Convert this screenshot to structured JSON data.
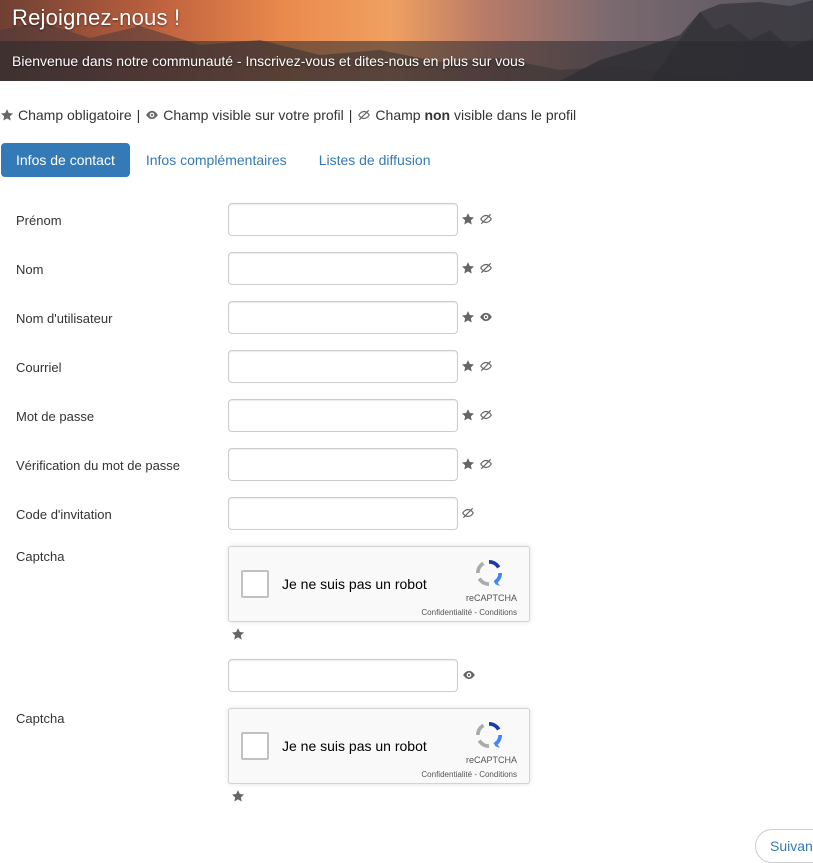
{
  "banner": {
    "title": "Rejoignez-nous !",
    "subtitle": "Bienvenue dans notre communauté - Inscrivez-vous et dites-nous en plus sur vous"
  },
  "legend": {
    "required": "Champ obligatoire",
    "separator": "|",
    "visible": "Champ visible sur votre profil",
    "not_visible_prefix": "Champ",
    "not_visible_bold": "non",
    "not_visible_suffix": "visible dans le profil"
  },
  "tabs": [
    {
      "label": "Infos de contact",
      "active": true
    },
    {
      "label": "Infos complémentaires",
      "active": false
    },
    {
      "label": "Listes de diffusion",
      "active": false
    }
  ],
  "fields": [
    {
      "label": "Prénom",
      "value": "",
      "required": true,
      "visibility": "hidden"
    },
    {
      "label": "Nom",
      "value": "",
      "required": true,
      "visibility": "hidden"
    },
    {
      "label": "Nom d'utilisateur",
      "value": "",
      "required": true,
      "visibility": "visible"
    },
    {
      "label": "Courriel",
      "value": "",
      "required": true,
      "visibility": "hidden"
    },
    {
      "label": "Mot de passe",
      "value": "",
      "required": true,
      "visibility": "hidden"
    },
    {
      "label": "Vérification du mot de passe",
      "value": "",
      "required": true,
      "visibility": "hidden"
    },
    {
      "label": "Code d'invitation",
      "value": "",
      "required": false,
      "visibility": "hidden"
    }
  ],
  "captcha": [
    {
      "label": "Captcha",
      "checkbox_label": "Je ne suis pas un robot",
      "brand": "reCAPTCHA",
      "links": "Confidentialité - Conditions",
      "required": true
    },
    {
      "label": "Captcha",
      "checkbox_label": "Je ne suis pas un robot",
      "brand": "reCAPTCHA",
      "links": "Confidentialité - Conditions",
      "required": true
    }
  ],
  "extra_field": {
    "value": "",
    "visibility": "visible"
  },
  "next_button": "Suivant",
  "colors": {
    "primary": "#337ab7",
    "icon": "#666666"
  },
  "icons": {
    "required": "star-icon",
    "visible": "eye-icon",
    "hidden": "eye-slash-icon",
    "recaptcha": "recaptcha-logo-icon"
  }
}
